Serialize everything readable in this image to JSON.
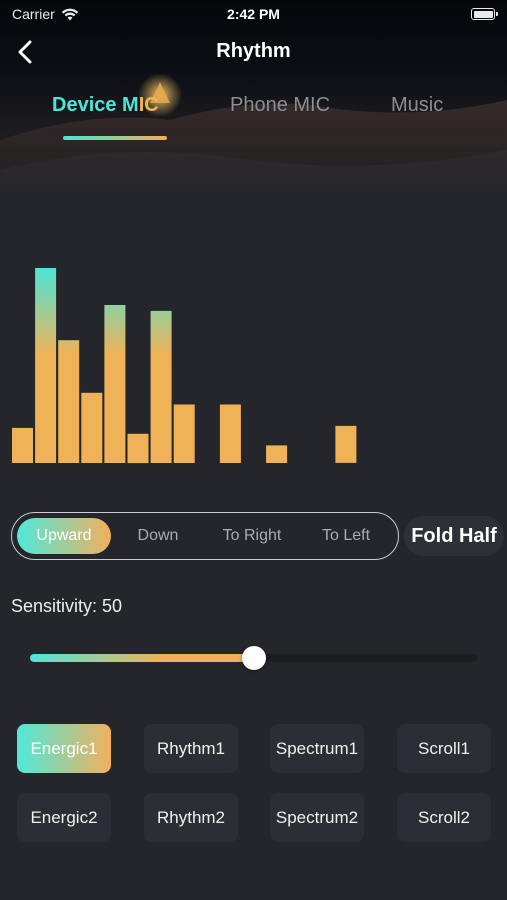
{
  "status_bar": {
    "carrier": "Carrier",
    "time": "2:42 PM"
  },
  "nav": {
    "title": "Rhythm"
  },
  "tabs": [
    {
      "label_a": "Device M",
      "label_b": "IC",
      "active": true
    },
    {
      "label": "Phone MIC",
      "active": false
    },
    {
      "label": "Music",
      "active": false
    }
  ],
  "visualizer": {
    "levels": [
      0.18,
      1.0,
      0.63,
      0.36,
      0.81,
      0.15,
      0.78,
      0.3,
      0,
      0.3,
      0,
      0.09,
      0,
      0,
      0.19
    ],
    "colors": {
      "base": "#f0b257",
      "peak": "#4de6d6"
    }
  },
  "direction": {
    "options": [
      "Upward",
      "Down",
      "To Right",
      "To Left"
    ],
    "active_index": 0,
    "fold_label": "Fold Half"
  },
  "sensitivity": {
    "label": "Sensitivity: 50",
    "value": 50,
    "max": 100
  },
  "modes": {
    "row1": [
      "Energic1",
      "Rhythm1",
      "Spectrum1",
      "Scroll1"
    ],
    "row2": [
      "Energic2",
      "Rhythm2",
      "Spectrum2",
      "Scroll2"
    ],
    "active": "Energic1"
  },
  "colors": {
    "accent_cyan": "#4de6d6",
    "accent_orange": "#f0b257",
    "background": "#24262b"
  }
}
